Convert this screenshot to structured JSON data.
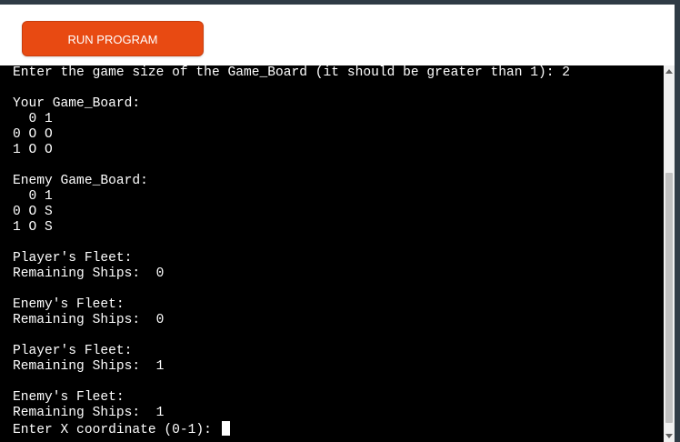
{
  "toolbar": {
    "run_button_label": "RUN PROGRAM",
    "button_color": "#e84a12"
  },
  "terminal": {
    "background": "#000000",
    "foreground": "#ffffff",
    "lines": [
      "Enter the game size of the Game_Board (it should be greater than 1): 2",
      "",
      "Your Game_Board:",
      "  0 1",
      "0 O O",
      "1 O O",
      "",
      "Enemy Game_Board:",
      "  0 1",
      "0 O S",
      "1 O S",
      "",
      "Player's Fleet:",
      "Remaining Ships:  0",
      "",
      "Enemy's Fleet:",
      "Remaining Ships:  0",
      "",
      "Player's Fleet:",
      "Remaining Ships:  1",
      "",
      "Enemy's Fleet:",
      "Remaining Ships:  1"
    ],
    "prompt": "Enter X coordinate (0-1): "
  },
  "icons": {
    "scroll_up": "chevron-up-icon",
    "scroll_down": "chevron-down-icon"
  }
}
